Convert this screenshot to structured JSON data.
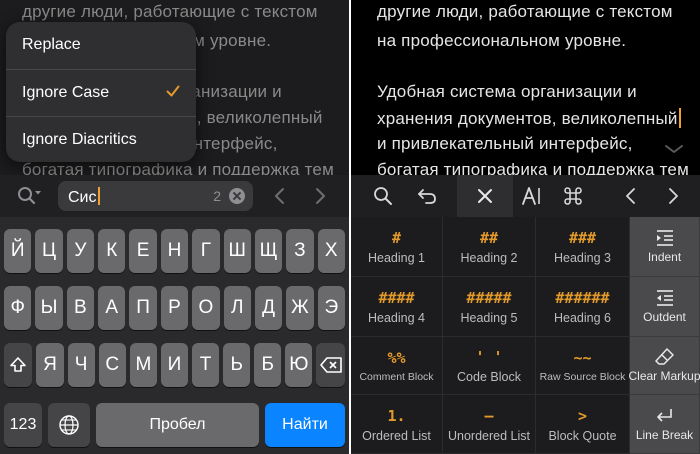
{
  "left": {
    "editor_lines": [
      "другие люди, работающие с текстом",
      "на профессиональном уровне.",
      "",
      "Удобная система организации и",
      "хранения документов, великолепный",
      "и привлекательный интерфейс,",
      "богатая типографика и поддержка тем"
    ],
    "menu": {
      "items": [
        "Replace",
        "Ignore Case",
        "Ignore Diacritics"
      ],
      "checked_index": 1
    },
    "find": {
      "query": "Сис",
      "match_count": "2"
    },
    "keyboard": {
      "row1": [
        "Й",
        "Ц",
        "У",
        "К",
        "Е",
        "Н",
        "Г",
        "Ш",
        "Щ",
        "З",
        "Х"
      ],
      "row2": [
        "Ф",
        "Ы",
        "В",
        "А",
        "П",
        "Р",
        "О",
        "Л",
        "Д",
        "Ж",
        "Э"
      ],
      "row3": [
        "Я",
        "Ч",
        "С",
        "М",
        "И",
        "Т",
        "Ь",
        "Б",
        "Ю"
      ],
      "numbers_key": "123",
      "space_key": "Пробел",
      "go_key": "Найти"
    }
  },
  "right": {
    "editor_lines": [
      "другие люди, работающие с текстом",
      "на профессиональном уровне.",
      "",
      "Удобная система организации и",
      "хранения документов, великолепный",
      "и привлекательный интерфейс,",
      "богатая типографика и поддержка тем"
    ],
    "toolbar": {
      "icons": [
        "search-icon",
        "undo-icon",
        "close-icon",
        "text-format-icon",
        "command-icon",
        "chevron-left-icon",
        "chevron-right-icon"
      ]
    },
    "grid": [
      {
        "symbol": "#",
        "label": "Heading 1"
      },
      {
        "symbol": "##",
        "label": "Heading 2"
      },
      {
        "symbol": "###",
        "label": "Heading 3"
      },
      {
        "symbol": "",
        "label": "Indent",
        "icon": "indent-icon"
      },
      {
        "symbol": "####",
        "label": "Heading 4"
      },
      {
        "symbol": "#####",
        "label": "Heading 5"
      },
      {
        "symbol": "######",
        "label": "Heading 6"
      },
      {
        "symbol": "",
        "label": "Outdent",
        "icon": "outdent-icon"
      },
      {
        "symbol": "%%",
        "label": "Comment Block"
      },
      {
        "symbol": "' '",
        "label": "Code Block"
      },
      {
        "symbol": "~~",
        "label": "Raw Source Block"
      },
      {
        "symbol": "",
        "label": "Clear Markup",
        "icon": "eraser-icon"
      },
      {
        "symbol": "1.",
        "label": "Ordered List"
      },
      {
        "symbol": "–",
        "label": "Unordered List"
      },
      {
        "symbol": ">",
        "label": "Block Quote"
      },
      {
        "symbol": "",
        "label": "Line Break",
        "icon": "return-icon"
      }
    ],
    "colors": {
      "accent": "#e39a2b",
      "caret": "#f0a030"
    }
  }
}
